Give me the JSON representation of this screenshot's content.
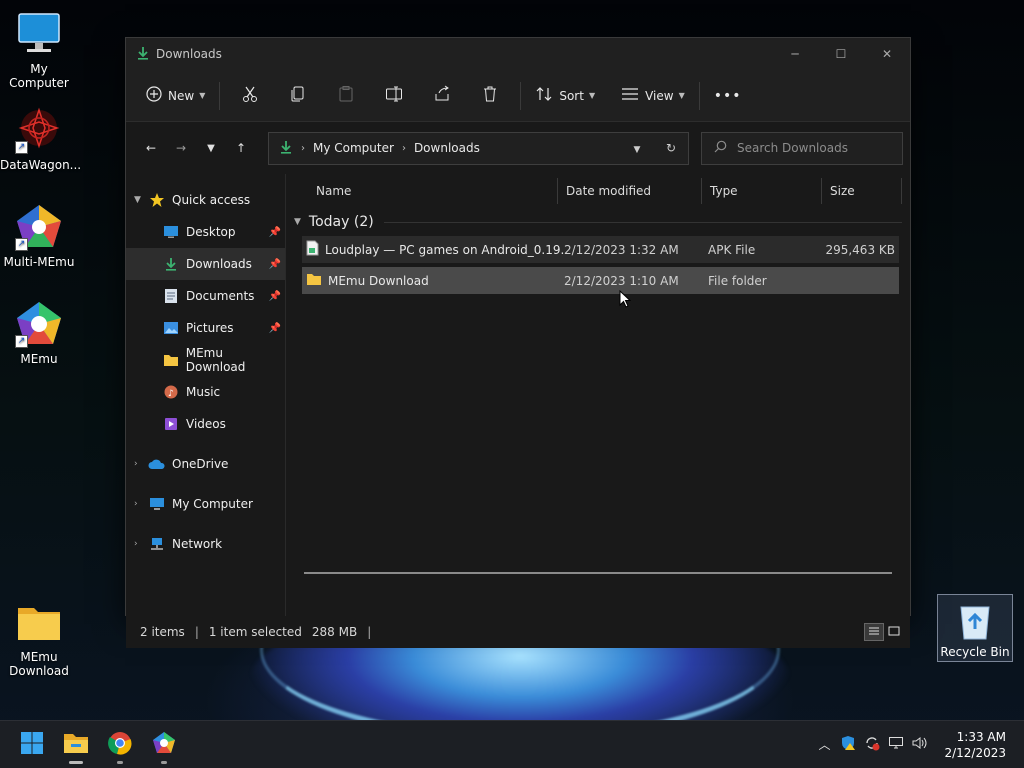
{
  "desktop": {
    "icons": [
      {
        "label": "My Computer"
      },
      {
        "label": "DataWagon..."
      },
      {
        "label": "Multi-MEmu"
      },
      {
        "label": "MEmu"
      },
      {
        "label": "MEmu Download"
      }
    ],
    "recycle_bin": "Recycle Bin"
  },
  "window": {
    "title": "Downloads",
    "toolbar": {
      "new_label": "New",
      "sort_label": "Sort",
      "view_label": "View",
      "more_label": "•••"
    },
    "address": {
      "crumbs": [
        "My Computer",
        "Downloads"
      ]
    },
    "search": {
      "placeholder": "Search Downloads"
    },
    "sidebar": {
      "quick_access": "Quick access",
      "items": [
        {
          "label": "Desktop"
        },
        {
          "label": "Downloads"
        },
        {
          "label": "Documents"
        },
        {
          "label": "Pictures"
        },
        {
          "label": "MEmu Download"
        },
        {
          "label": "Music"
        },
        {
          "label": "Videos"
        }
      ],
      "onedrive": "OneDrive",
      "my_computer": "My Computer",
      "network": "Network"
    },
    "columns": {
      "name": "Name",
      "date": "Date modified",
      "type": "Type",
      "size": "Size"
    },
    "group": {
      "label": "Today (2)"
    },
    "files": [
      {
        "name": "Loudplay — PC games on Android_0.19....",
        "date": "2/12/2023 1:32 AM",
        "type": "APK File",
        "size": "295,463 KB"
      },
      {
        "name": "MEmu Download",
        "date": "2/12/2023 1:10 AM",
        "type": "File folder",
        "size": ""
      }
    ],
    "status": {
      "count": "2 items",
      "selected": "1 item selected",
      "size": "288 MB"
    }
  },
  "taskbar": {
    "time": "1:33 AM",
    "date": "2/12/2023"
  },
  "colors": {
    "window_bg": "#202020",
    "accent_green": "#3cb371",
    "folder_yellow": "#f5c542"
  }
}
